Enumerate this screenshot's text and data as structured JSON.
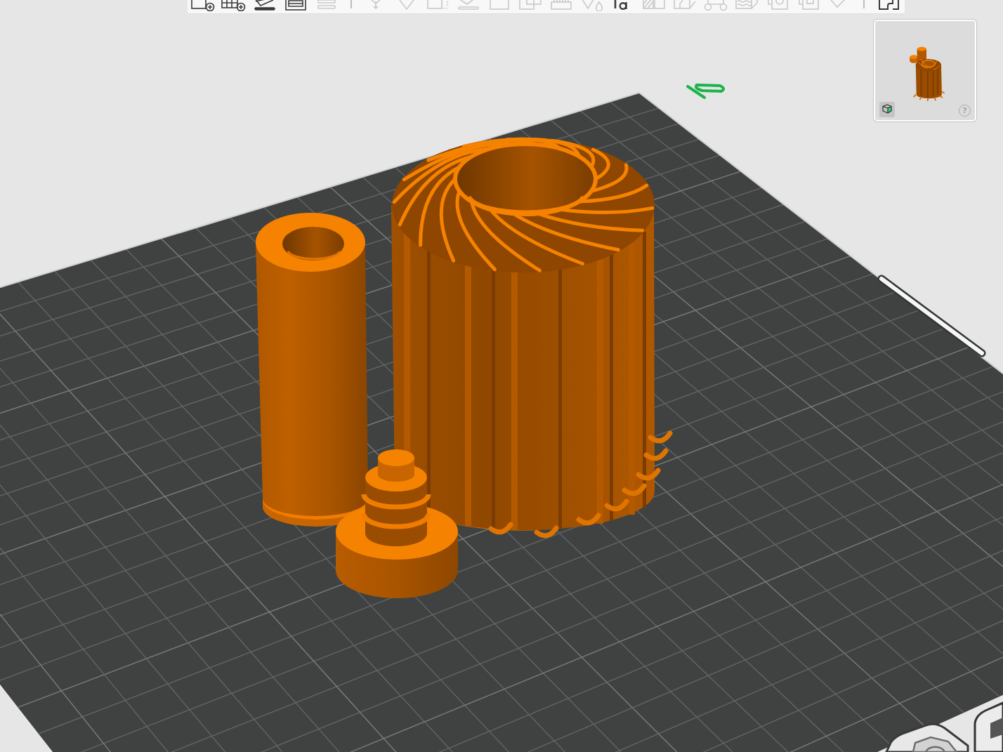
{
  "toolbar": {
    "groups": [
      {
        "buttons": [
          {
            "kind": "add",
            "disabled": false
          },
          {
            "kind": "plate",
            "disabled": false
          },
          {
            "kind": "arrange",
            "disabled": false
          },
          {
            "kind": "layout",
            "disabled": false
          },
          {
            "kind": "layers",
            "disabled": true
          }
        ]
      },
      {
        "buttons": [
          {
            "kind": "move",
            "disabled": true
          },
          {
            "kind": "rotate",
            "disabled": true
          },
          {
            "kind": "scale",
            "disabled": true
          },
          {
            "kind": "lay",
            "disabled": true
          },
          {
            "kind": "cut",
            "disabled": true
          },
          {
            "kind": "boolean",
            "disabled": true
          },
          {
            "kind": "support",
            "disabled": true
          },
          {
            "kind": "seam",
            "disabled": true
          },
          {
            "kind": "text",
            "disabled": false
          },
          {
            "kind": "paint",
            "disabled": true
          },
          {
            "kind": "split",
            "disabled": true
          },
          {
            "kind": "assembly",
            "disabled": true
          },
          {
            "kind": "fuzzy",
            "disabled": true
          },
          {
            "kind": "measure",
            "disabled": true
          },
          {
            "kind": "emboss",
            "disabled": true
          },
          {
            "kind": "check",
            "disabled": true
          }
        ]
      },
      {
        "buttons": [
          {
            "kind": "view",
            "disabled": false
          }
        ]
      }
    ]
  },
  "build_plate": {
    "models": [
      {
        "kind": "tube"
      },
      {
        "kind": "fan"
      },
      {
        "kind": "knob"
      }
    ]
  },
  "navigator": {
    "help_label": "?"
  }
}
